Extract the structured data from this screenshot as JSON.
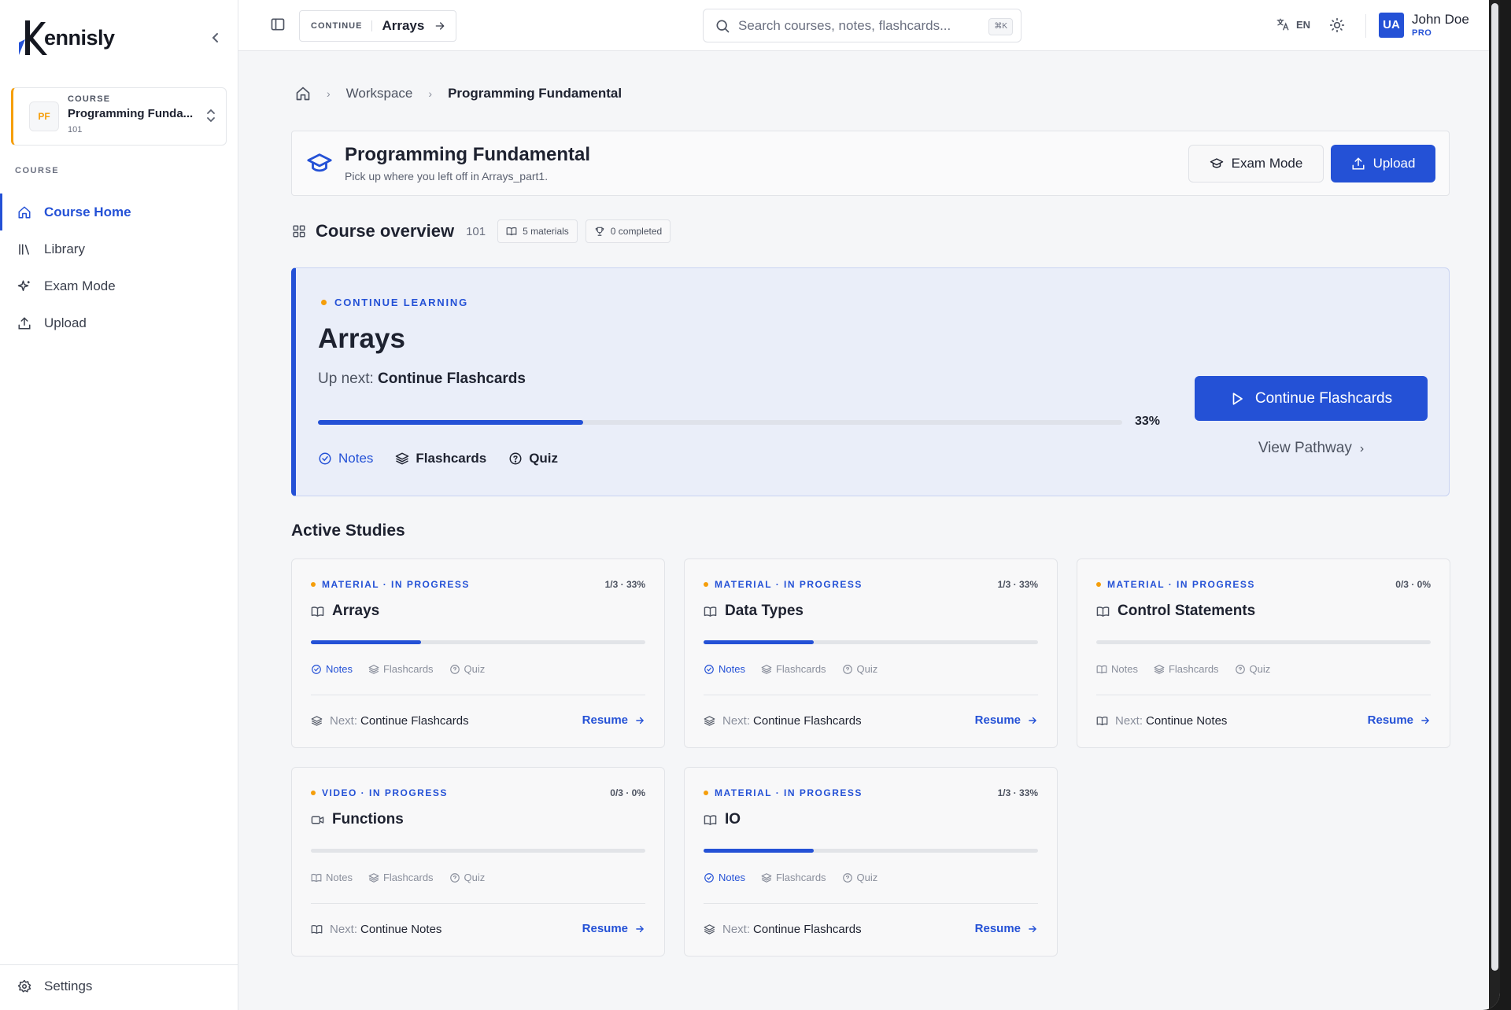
{
  "app": {
    "brand": "ennisly"
  },
  "sidebar": {
    "course_switcher": {
      "badge": "PF",
      "label": "COURSE",
      "name": "Programming Funda...",
      "code": "101"
    },
    "section_label": "COURSE",
    "items": [
      {
        "label": "Course Home",
        "icon": "home-icon",
        "active": true
      },
      {
        "label": "Library",
        "icon": "library-icon",
        "active": false
      },
      {
        "label": "Exam Mode",
        "icon": "sparkles-icon",
        "active": false
      },
      {
        "label": "Upload",
        "icon": "upload-icon",
        "active": false
      }
    ],
    "settings_label": "Settings"
  },
  "topbar": {
    "continue_label": "CONTINUE",
    "continue_title": "Arrays",
    "search_placeholder": "Search courses, notes, flashcards...",
    "search_kbd": "⌘K",
    "language": "EN",
    "user": {
      "initials": "UA",
      "name": "John Doe",
      "plan": "PRO"
    }
  },
  "breadcrumb": {
    "items": [
      "Workspace",
      "Programming Fundamental"
    ]
  },
  "course_header": {
    "title": "Programming Fundamental",
    "subtitle": "Pick up where you left off in Arrays_part1.",
    "exam_button": "Exam Mode",
    "upload_button": "Upload"
  },
  "overview": {
    "title": "Course overview",
    "code": "101",
    "materials": "5 materials",
    "completed": "0 completed"
  },
  "continue_learning": {
    "label": "CONTINUE LEARNING",
    "title": "Arrays",
    "up_next_prefix": "Up next:",
    "up_next": "Continue Flashcards",
    "progress": 33,
    "progress_text": "33%",
    "steps": [
      {
        "label": "Notes",
        "done": true
      },
      {
        "label": "Flashcards",
        "done": false
      },
      {
        "label": "Quiz",
        "done": false
      }
    ],
    "primary_button": "Continue Flashcards",
    "secondary_link": "View Pathway"
  },
  "active_studies": {
    "title": "Active Studies",
    "cards": [
      {
        "tag": "MATERIAL · IN PROGRESS",
        "progress_text": "1/3 · 33%",
        "progress": 33,
        "title": "Arrays",
        "type_icon": "book-icon",
        "steps": [
          "Notes",
          "Flashcards",
          "Quiz"
        ],
        "done": [
          true,
          false,
          false
        ],
        "next_prefix": "Next:",
        "next": "Continue Flashcards",
        "next_icon": "layers-icon",
        "resume": "Resume"
      },
      {
        "tag": "MATERIAL · IN PROGRESS",
        "progress_text": "1/3 · 33%",
        "progress": 33,
        "title": "Data Types",
        "type_icon": "book-icon",
        "steps": [
          "Notes",
          "Flashcards",
          "Quiz"
        ],
        "done": [
          true,
          false,
          false
        ],
        "next_prefix": "Next:",
        "next": "Continue Flashcards",
        "next_icon": "layers-icon",
        "resume": "Resume"
      },
      {
        "tag": "MATERIAL · IN PROGRESS",
        "progress_text": "0/3 · 0%",
        "progress": 0,
        "title": "Control Statements",
        "type_icon": "book-icon",
        "steps": [
          "Notes",
          "Flashcards",
          "Quiz"
        ],
        "done": [
          false,
          false,
          false
        ],
        "next_prefix": "Next:",
        "next": "Continue Notes",
        "next_icon": "book-icon",
        "resume": "Resume"
      },
      {
        "tag": "VIDEO · IN PROGRESS",
        "progress_text": "0/3 · 0%",
        "progress": 0,
        "title": "Functions",
        "type_icon": "video-icon",
        "steps": [
          "Notes",
          "Flashcards",
          "Quiz"
        ],
        "done": [
          false,
          false,
          false
        ],
        "next_prefix": "Next:",
        "next": "Continue Notes",
        "next_icon": "book-icon",
        "resume": "Resume"
      },
      {
        "tag": "MATERIAL · IN PROGRESS",
        "progress_text": "1/3 · 33%",
        "progress": 33,
        "title": "IO",
        "type_icon": "book-icon",
        "steps": [
          "Notes",
          "Flashcards",
          "Quiz"
        ],
        "done": [
          true,
          false,
          false
        ],
        "next_prefix": "Next:",
        "next": "Continue Flashcards",
        "next_icon": "layers-icon",
        "resume": "Resume"
      }
    ]
  },
  "colors": {
    "accent": "#2451d6",
    "warning": "#f59e0b",
    "text": "#1e2230",
    "muted": "#6b7080"
  }
}
